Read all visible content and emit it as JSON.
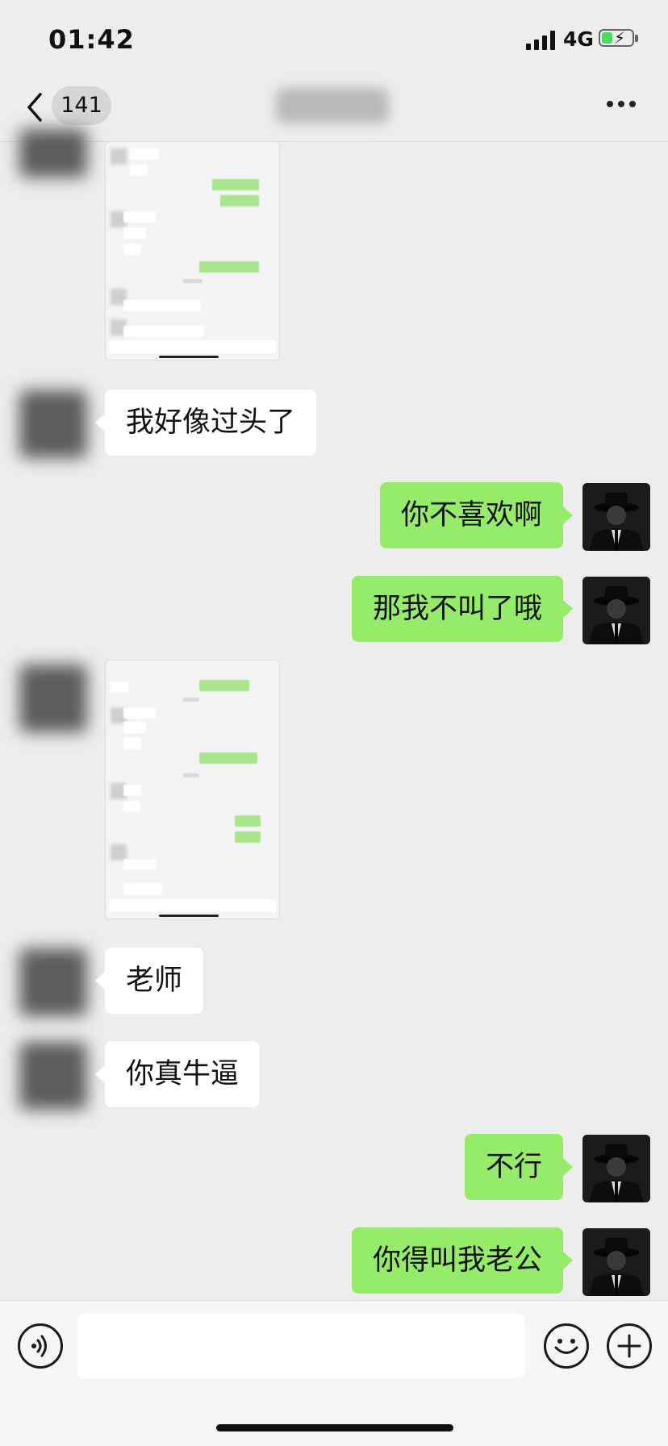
{
  "status_bar": {
    "time": "01:42",
    "network": "4G",
    "battery_level": 0.35
  },
  "nav": {
    "unread_count": "141"
  },
  "messages": [
    {
      "side": "in",
      "kind": "image"
    },
    {
      "side": "in",
      "kind": "text",
      "text": "我好像过头了"
    },
    {
      "side": "out",
      "kind": "text",
      "text": "你不喜欢啊"
    },
    {
      "side": "out",
      "kind": "text",
      "text": "那我不叫了哦"
    },
    {
      "side": "in",
      "kind": "image"
    },
    {
      "side": "in",
      "kind": "text",
      "text": "老师"
    },
    {
      "side": "in",
      "kind": "text",
      "text": "你真牛逼"
    },
    {
      "side": "out",
      "kind": "text",
      "text": "不行"
    },
    {
      "side": "out",
      "kind": "text",
      "text": "你得叫我老公"
    }
  ],
  "input": {
    "value": ""
  },
  "icons": {
    "back": "chevron-left-icon",
    "more": "more-icon",
    "voice": "voice-icon",
    "emoji": "emoji-icon",
    "plus": "plus-icon"
  },
  "colors": {
    "background": "#ededed",
    "outgoing_bubble": "#95ec69",
    "incoming_bubble": "#ffffff"
  }
}
